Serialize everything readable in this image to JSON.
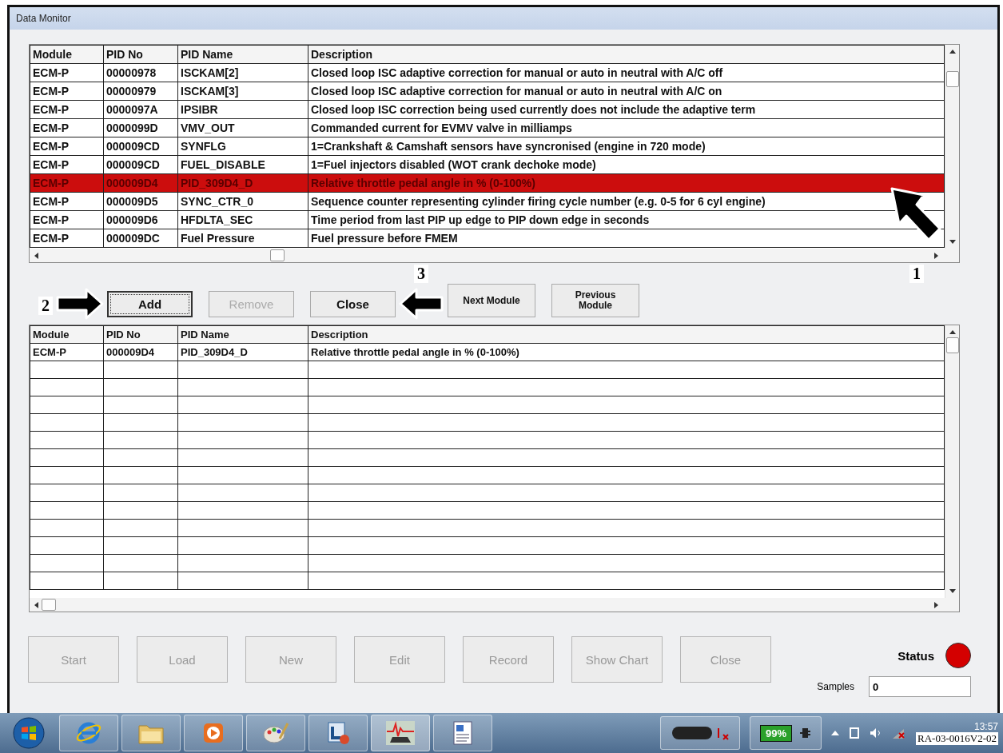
{
  "window": {
    "title": "Data Monitor"
  },
  "pid_table": {
    "columns": [
      "Module",
      "PID No",
      "PID Name",
      "Description"
    ],
    "rows": [
      {
        "cells": [
          "ECM-P",
          "00000978",
          "ISCKAM[2]",
          "Closed loop ISC adaptive correction for manual or auto in neutral with A/C off"
        ],
        "selected": false
      },
      {
        "cells": [
          "ECM-P",
          "00000979",
          "ISCKAM[3]",
          "Closed loop ISC adaptive correction for manual or auto in neutral with A/C on"
        ],
        "selected": false
      },
      {
        "cells": [
          "ECM-P",
          "0000097A",
          "IPSIBR",
          "Closed loop ISC correction being used currently does not include the adaptive term"
        ],
        "selected": false
      },
      {
        "cells": [
          "ECM-P",
          "0000099D",
          "VMV_OUT",
          "Commanded current for EVMV valve in milliamps"
        ],
        "selected": false
      },
      {
        "cells": [
          "ECM-P",
          "000009CD",
          "SYNFLG",
          "1=Crankshaft & Camshaft sensors have syncronised (engine in 720 mode)"
        ],
        "selected": false
      },
      {
        "cells": [
          "ECM-P",
          "000009CD",
          "FUEL_DISABLE",
          "1=Fuel injectors disabled (WOT crank dechoke mode)"
        ],
        "selected": false
      },
      {
        "cells": [
          "ECM-P",
          "000009D4",
          "PID_309D4_D",
          "Relative throttle pedal angle in % (0-100%)"
        ],
        "selected": true
      },
      {
        "cells": [
          "ECM-P",
          "000009D5",
          "SYNC_CTR_0",
          "Sequence counter representing cylinder firing cycle number (e.g. 0-5 for 6 cyl engine)"
        ],
        "selected": false
      },
      {
        "cells": [
          "ECM-P",
          "000009D6",
          "HFDLTA_SEC",
          "Time period from last PIP up edge to PIP down edge in seconds"
        ],
        "selected": false
      },
      {
        "cells": [
          "ECM-P",
          "000009DC",
          "Fuel Pressure",
          "Fuel pressure before FMEM"
        ],
        "selected": false
      }
    ]
  },
  "pid_buttons": [
    {
      "label": "Add",
      "kind": "standard",
      "disabled": false,
      "focused": true
    },
    {
      "label": "Remove",
      "kind": "standard",
      "disabled": true,
      "focused": false
    },
    {
      "label": "Close",
      "kind": "standard",
      "disabled": false,
      "focused": false
    },
    {
      "label": "Next Module",
      "kind": "compact",
      "disabled": false,
      "focused": false
    },
    {
      "label": "Previous Module",
      "kind": "compact",
      "disabled": false,
      "focused": false
    }
  ],
  "callouts": [
    {
      "number": "1"
    },
    {
      "number": "2"
    },
    {
      "number": "3"
    }
  ],
  "monitor_table": {
    "columns": [
      "Module",
      "PID No",
      "PID Name",
      "Description"
    ],
    "rows": [
      {
        "cells": [
          "ECM-P",
          "000009D4",
          "PID_309D4_D",
          "Relative throttle pedal angle in % (0-100%)"
        ]
      }
    ]
  },
  "control_buttons": [
    {
      "label": "Start",
      "disabled": true
    },
    {
      "label": "Load",
      "disabled": true
    },
    {
      "label": "New",
      "disabled": true
    },
    {
      "label": "Edit",
      "disabled": true
    },
    {
      "label": "Record",
      "disabled": true
    },
    {
      "label": "Show Chart",
      "disabled": true
    },
    {
      "label": "Close",
      "disabled": true
    }
  ],
  "status": {
    "label": "Status",
    "running": false
  },
  "samples": {
    "label": "Samples",
    "value": "0"
  },
  "taskbar": {
    "battery": "99%",
    "clock": "13:57",
    "figure_label": "RA-03-0016V2-02"
  }
}
